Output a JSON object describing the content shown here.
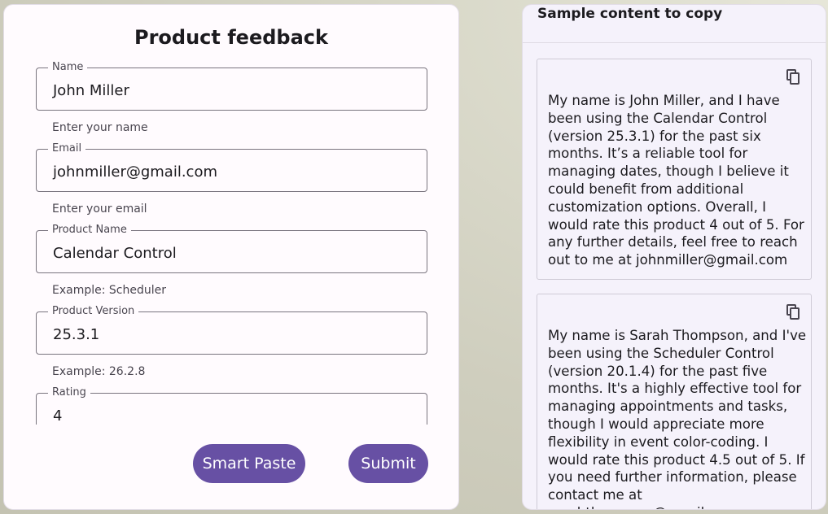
{
  "form": {
    "title": "Product feedback",
    "fields": [
      {
        "label": "Name",
        "value": "John Miller",
        "helper": "Enter your name"
      },
      {
        "label": "Email",
        "value": "johnmiller@gmail.com",
        "helper": "Enter your email"
      },
      {
        "label": "Product Name",
        "value": "Calendar Control",
        "helper": "Example: Scheduler"
      },
      {
        "label": "Product Version",
        "value": "25.3.1",
        "helper": "Example: 26.2.8"
      },
      {
        "label": "Rating",
        "value": "4"
      }
    ],
    "smart_paste_label": "Smart Paste",
    "submit_label": "Submit"
  },
  "samples": {
    "title": "Sample content to copy",
    "items": [
      {
        "text": "My name is John Miller, and I have been using the Calendar Control (version 25.3.1) for the past six months. It’s a reliable tool for managing dates, though I believe it could benefit from additional customization options. Overall, I would rate this product 4 out of 5. For any further details, feel free to reach out to me at johnmiller@gmail.com",
        "icon": "copy-icon"
      },
      {
        "text": "My name is Sarah Thompson, and I've been using the Scheduler Control (version 20.1.4) for the past five months. It's a highly effective tool for managing appointments and tasks, though I would appreciate more flexibility in event color-coding. I would rate this product 4.5 out of 5. If you need further information, please contact me at sarahthompson@gmail.com.",
        "icon": "copy-icon"
      }
    ]
  },
  "colors": {
    "accent": "#6750a4",
    "outline": "#79747e",
    "surface": "#fffbfe"
  }
}
